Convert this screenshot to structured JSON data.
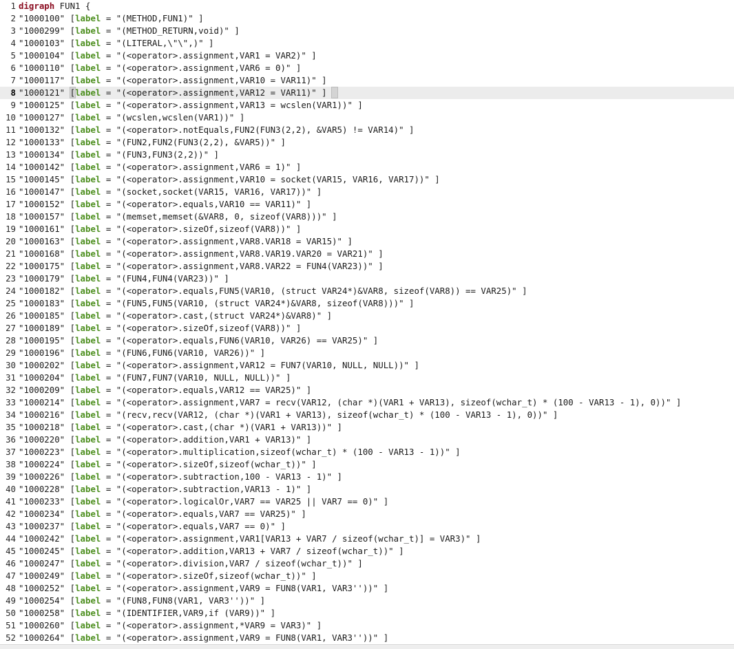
{
  "editor": {
    "current_line": 8,
    "lines": [
      {
        "num": "1",
        "kind": "header",
        "keyword": "digraph",
        "rest": " FUN1 {"
      },
      {
        "num": "2",
        "id": "\"1000100\"",
        "attr": "label",
        "value": "\"(METHOD,FUN1)\" ]"
      },
      {
        "num": "3",
        "id": "\"1000299\"",
        "attr": "label",
        "value": "\"(METHOD_RETURN,void)\" ]"
      },
      {
        "num": "4",
        "id": "\"1000103\"",
        "attr": "label",
        "value": "\"(LITERAL,\\\"\\\",)\" ]"
      },
      {
        "num": "5",
        "id": "\"1000104\"",
        "attr": "label",
        "value": "\"(<operator>.assignment,VAR1 = VAR2)\" ]"
      },
      {
        "num": "6",
        "id": "\"1000110\"",
        "attr": "label",
        "value": "\"(<operator>.assignment,VAR6 = 0)\" ]"
      },
      {
        "num": "7",
        "id": "\"1000117\"",
        "attr": "label",
        "value": "\"(<operator>.assignment,VAR10 = VAR11)\" ]"
      },
      {
        "num": "8",
        "id": "\"1000121\"",
        "attr": "label",
        "value": "\"(<operator>.assignment,VAR12 = VAR11)\" ]"
      },
      {
        "num": "9",
        "id": "\"1000125\"",
        "attr": "label",
        "value": "\"(<operator>.assignment,VAR13 = wcslen(VAR1))\" ]"
      },
      {
        "num": "10",
        "id": "\"1000127\"",
        "attr": "label",
        "value": "\"(wcslen,wcslen(VAR1))\" ]"
      },
      {
        "num": "11",
        "id": "\"1000132\"",
        "attr": "label",
        "value": "\"(<operator>.notEquals,FUN2(FUN3(2,2), &VAR5) != VAR14)\" ]"
      },
      {
        "num": "12",
        "id": "\"1000133\"",
        "attr": "label",
        "value": "\"(FUN2,FUN2(FUN3(2,2), &VAR5))\" ]"
      },
      {
        "num": "13",
        "id": "\"1000134\"",
        "attr": "label",
        "value": "\"(FUN3,FUN3(2,2))\" ]"
      },
      {
        "num": "14",
        "id": "\"1000142\"",
        "attr": "label",
        "value": "\"(<operator>.assignment,VAR6 = 1)\" ]"
      },
      {
        "num": "15",
        "id": "\"1000145\"",
        "attr": "label",
        "value": "\"(<operator>.assignment,VAR10 = socket(VAR15, VAR16, VAR17))\" ]"
      },
      {
        "num": "16",
        "id": "\"1000147\"",
        "attr": "label",
        "value": "\"(socket,socket(VAR15, VAR16, VAR17))\" ]"
      },
      {
        "num": "17",
        "id": "\"1000152\"",
        "attr": "label",
        "value": "\"(<operator>.equals,VAR10 == VAR11)\" ]"
      },
      {
        "num": "18",
        "id": "\"1000157\"",
        "attr": "label",
        "value": "\"(memset,memset(&VAR8, 0, sizeof(VAR8)))\" ]"
      },
      {
        "num": "19",
        "id": "\"1000161\"",
        "attr": "label",
        "value": "\"(<operator>.sizeOf,sizeof(VAR8))\" ]"
      },
      {
        "num": "20",
        "id": "\"1000163\"",
        "attr": "label",
        "value": "\"(<operator>.assignment,VAR8.VAR18 = VAR15)\" ]"
      },
      {
        "num": "21",
        "id": "\"1000168\"",
        "attr": "label",
        "value": "\"(<operator>.assignment,VAR8.VAR19.VAR20 = VAR21)\" ]"
      },
      {
        "num": "22",
        "id": "\"1000175\"",
        "attr": "label",
        "value": "\"(<operator>.assignment,VAR8.VAR22 = FUN4(VAR23))\" ]"
      },
      {
        "num": "23",
        "id": "\"1000179\"",
        "attr": "label",
        "value": "\"(FUN4,FUN4(VAR23))\" ]"
      },
      {
        "num": "24",
        "id": "\"1000182\"",
        "attr": "label",
        "value": "\"(<operator>.equals,FUN5(VAR10, (struct VAR24*)&VAR8, sizeof(VAR8)) == VAR25)\" ]"
      },
      {
        "num": "25",
        "id": "\"1000183\"",
        "attr": "label",
        "value": "\"(FUN5,FUN5(VAR10, (struct VAR24*)&VAR8, sizeof(VAR8)))\" ]"
      },
      {
        "num": "26",
        "id": "\"1000185\"",
        "attr": "label",
        "value": "\"(<operator>.cast,(struct VAR24*)&VAR8)\" ]"
      },
      {
        "num": "27",
        "id": "\"1000189\"",
        "attr": "label",
        "value": "\"(<operator>.sizeOf,sizeof(VAR8))\" ]"
      },
      {
        "num": "28",
        "id": "\"1000195\"",
        "attr": "label",
        "value": "\"(<operator>.equals,FUN6(VAR10, VAR26) == VAR25)\" ]"
      },
      {
        "num": "29",
        "id": "\"1000196\"",
        "attr": "label",
        "value": "\"(FUN6,FUN6(VAR10, VAR26))\" ]"
      },
      {
        "num": "30",
        "id": "\"1000202\"",
        "attr": "label",
        "value": "\"(<operator>.assignment,VAR12 = FUN7(VAR10, NULL, NULL))\" ]"
      },
      {
        "num": "31",
        "id": "\"1000204\"",
        "attr": "label",
        "value": "\"(FUN7,FUN7(VAR10, NULL, NULL))\" ]"
      },
      {
        "num": "32",
        "id": "\"1000209\"",
        "attr": "label",
        "value": "\"(<operator>.equals,VAR12 == VAR25)\" ]"
      },
      {
        "num": "33",
        "id": "\"1000214\"",
        "attr": "label",
        "value": "\"(<operator>.assignment,VAR7 = recv(VAR12, (char *)(VAR1 + VAR13), sizeof(wchar_t) * (100 - VAR13 - 1), 0))\" ]"
      },
      {
        "num": "34",
        "id": "\"1000216\"",
        "attr": "label",
        "value": "\"(recv,recv(VAR12, (char *)(VAR1 + VAR13), sizeof(wchar_t) * (100 - VAR13 - 1), 0))\" ]"
      },
      {
        "num": "35",
        "id": "\"1000218\"",
        "attr": "label",
        "value": "\"(<operator>.cast,(char *)(VAR1 + VAR13))\" ]"
      },
      {
        "num": "36",
        "id": "\"1000220\"",
        "attr": "label",
        "value": "\"(<operator>.addition,VAR1 + VAR13)\" ]"
      },
      {
        "num": "37",
        "id": "\"1000223\"",
        "attr": "label",
        "value": "\"(<operator>.multiplication,sizeof(wchar_t) * (100 - VAR13 - 1))\" ]"
      },
      {
        "num": "38",
        "id": "\"1000224\"",
        "attr": "label",
        "value": "\"(<operator>.sizeOf,sizeof(wchar_t))\" ]"
      },
      {
        "num": "39",
        "id": "\"1000226\"",
        "attr": "label",
        "value": "\"(<operator>.subtraction,100 - VAR13 - 1)\" ]"
      },
      {
        "num": "40",
        "id": "\"1000228\"",
        "attr": "label",
        "value": "\"(<operator>.subtraction,VAR13 - 1)\" ]"
      },
      {
        "num": "41",
        "id": "\"1000233\"",
        "attr": "label",
        "value": "\"(<operator>.logicalOr,VAR7 == VAR25 || VAR7 == 0)\" ]"
      },
      {
        "num": "42",
        "id": "\"1000234\"",
        "attr": "label",
        "value": "\"(<operator>.equals,VAR7 == VAR25)\" ]"
      },
      {
        "num": "43",
        "id": "\"1000237\"",
        "attr": "label",
        "value": "\"(<operator>.equals,VAR7 == 0)\" ]"
      },
      {
        "num": "44",
        "id": "\"1000242\"",
        "attr": "label",
        "value": "\"(<operator>.assignment,VAR1[VAR13 + VAR7 / sizeof(wchar_t)] = VAR3)\" ]"
      },
      {
        "num": "45",
        "id": "\"1000245\"",
        "attr": "label",
        "value": "\"(<operator>.addition,VAR13 + VAR7 / sizeof(wchar_t))\" ]"
      },
      {
        "num": "46",
        "id": "\"1000247\"",
        "attr": "label",
        "value": "\"(<operator>.division,VAR7 / sizeof(wchar_t))\" ]"
      },
      {
        "num": "47",
        "id": "\"1000249\"",
        "attr": "label",
        "value": "\"(<operator>.sizeOf,sizeof(wchar_t))\" ]"
      },
      {
        "num": "48",
        "id": "\"1000252\"",
        "attr": "label",
        "value": "\"(<operator>.assignment,VAR9 = FUN8(VAR1, VAR3''))\" ]"
      },
      {
        "num": "49",
        "id": "\"1000254\"",
        "attr": "label",
        "value": "\"(FUN8,FUN8(VAR1, VAR3''))\" ]"
      },
      {
        "num": "50",
        "id": "\"1000258\"",
        "attr": "label",
        "value": "\"(IDENTIFIER,VAR9,if (VAR9))\" ]"
      },
      {
        "num": "51",
        "id": "\"1000260\"",
        "attr": "label",
        "value": "\"(<operator>.assignment,*VAR9 = VAR3)\" ]"
      },
      {
        "num": "52",
        "id": "\"1000264\"",
        "attr": "label",
        "value": "\"(<operator>.assignment,VAR9 = FUN8(VAR1, VAR3''))\" ]"
      }
    ]
  }
}
